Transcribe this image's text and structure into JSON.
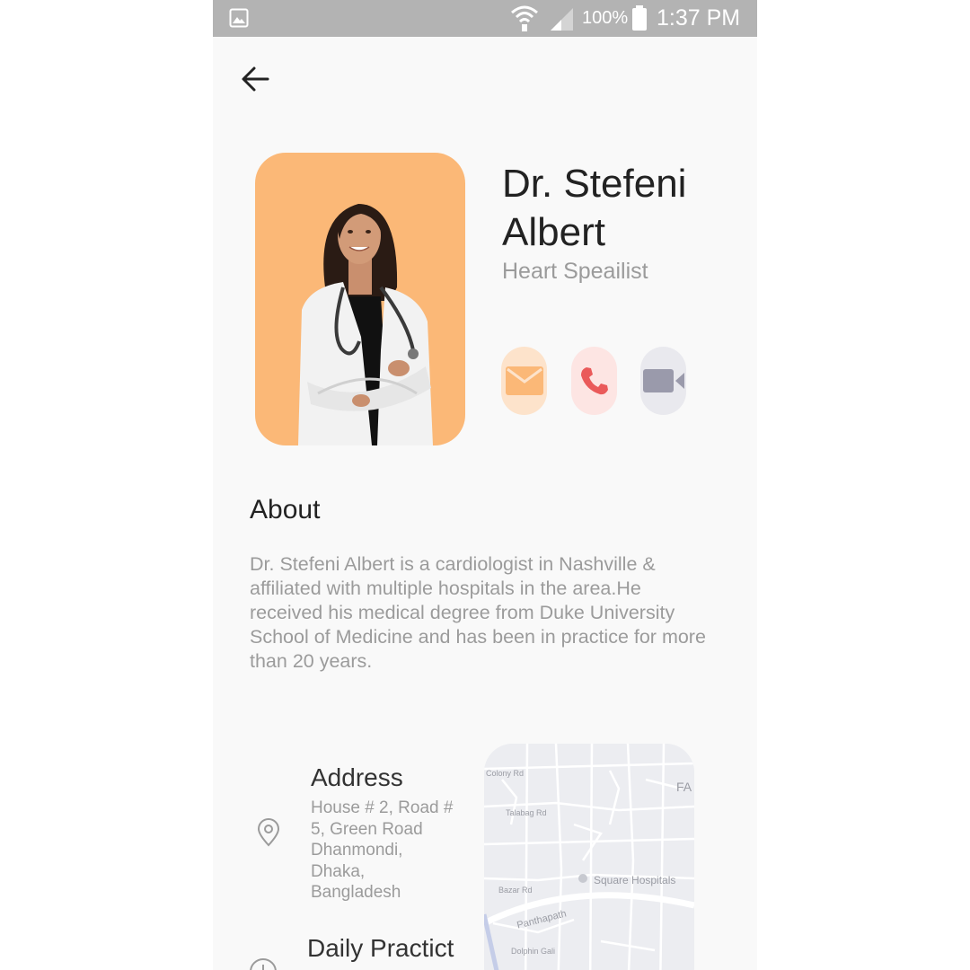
{
  "status_bar": {
    "battery_percent": "100%",
    "time": "1:37 PM",
    "icons": [
      "gallery-icon",
      "wifi-icon",
      "signal-icon",
      "battery-icon"
    ]
  },
  "doctor": {
    "name": "Dr. Stefeni Albert",
    "specialty": "Heart Speailist"
  },
  "contact_buttons": [
    {
      "name": "mail",
      "icon": "mail-icon",
      "color": "#fbb877"
    },
    {
      "name": "phone",
      "icon": "phone-icon",
      "color": "#ea5a5a"
    },
    {
      "name": "video",
      "icon": "video-icon",
      "color": "#9a9aab"
    }
  ],
  "about": {
    "title": "About",
    "text": "Dr. Stefeni Albert is a cardiologist in Nashville & affiliated with multiple hospitals in the  area.He received his medical degree from Duke University School of Medicine and has been in practice for more than 20 years."
  },
  "address": {
    "title": "Address",
    "text": "House # 2, Road # 5, Green Road Dhanmondi, Dhaka, Bangladesh"
  },
  "daily_practice": {
    "title": "Daily Practict"
  },
  "map": {
    "labels": {
      "colony": "Colony Rd",
      "talabag": "Talabag Rd",
      "hospital": "Square Hospitals",
      "bazar": "Bazar Rd",
      "panthapath": "Panthapath",
      "dolphin": "Dolphin Gali",
      "fa": "FA"
    }
  },
  "colors": {
    "photo_bg": "#fbb877",
    "text_dark": "#222222",
    "text_muted": "#9b9b9b",
    "status_bar": "#b3b3b3"
  }
}
